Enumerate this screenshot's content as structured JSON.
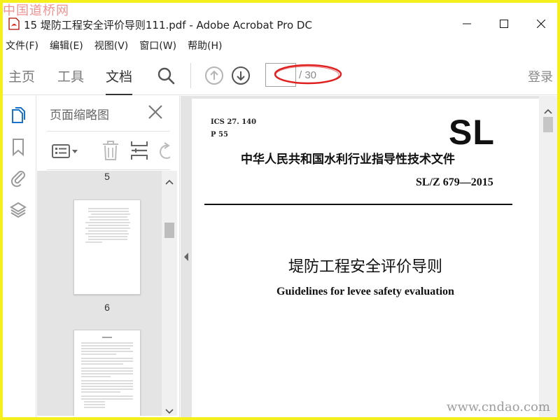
{
  "watermark": {
    "top": "中国道桥网",
    "bottom": "www.cndao.com"
  },
  "window": {
    "title": "15 堤防工程安全评价导则111.pdf - Adobe Acrobat Pro DC"
  },
  "menu": [
    {
      "label": "文件(F)"
    },
    {
      "label": "编辑(E)"
    },
    {
      "label": "视图(V)"
    },
    {
      "label": "窗口(W)"
    },
    {
      "label": "帮助(H)"
    }
  ],
  "toolbar": {
    "home_label": "主页",
    "tools_label": "工具",
    "document_label": "文档",
    "page_value": "",
    "page_total": "/ 30",
    "login_label": "登录",
    "annotation_color": "#e02020"
  },
  "icons": {
    "app": "acrobat-pdf-icon",
    "search": "search-icon",
    "prev_page": "arrow-up-circle-icon",
    "next_page": "arrow-down-circle-icon",
    "page_thumbnails": "pages-icon",
    "bookmarks": "bookmark-icon",
    "attachments": "paperclip-icon",
    "layers": "layers-icon",
    "panel_close": "close-icon",
    "options": "options-menu-icon",
    "delete": "trash-icon",
    "insert": "insert-page-icon",
    "rotate": "rotate-icon"
  },
  "thumbnails": {
    "title": "页面缩略图",
    "partial_label": "5",
    "pages": [
      {
        "label": "6"
      }
    ]
  },
  "document": {
    "ics": "ICS 27. 140",
    "p_number": "P 55",
    "logo": "SL",
    "organization": "中华人民共和国水利行业指导性技术文件",
    "standard_code": "SL/Z 679—2015",
    "title_cn": "堤防工程安全评价导则",
    "title_en": "Guidelines for levee safety evaluation"
  },
  "colors": {
    "frame": "#f5ef1c",
    "accent_blue": "#1a73c8",
    "panel_bg": "#e4e4e4"
  }
}
